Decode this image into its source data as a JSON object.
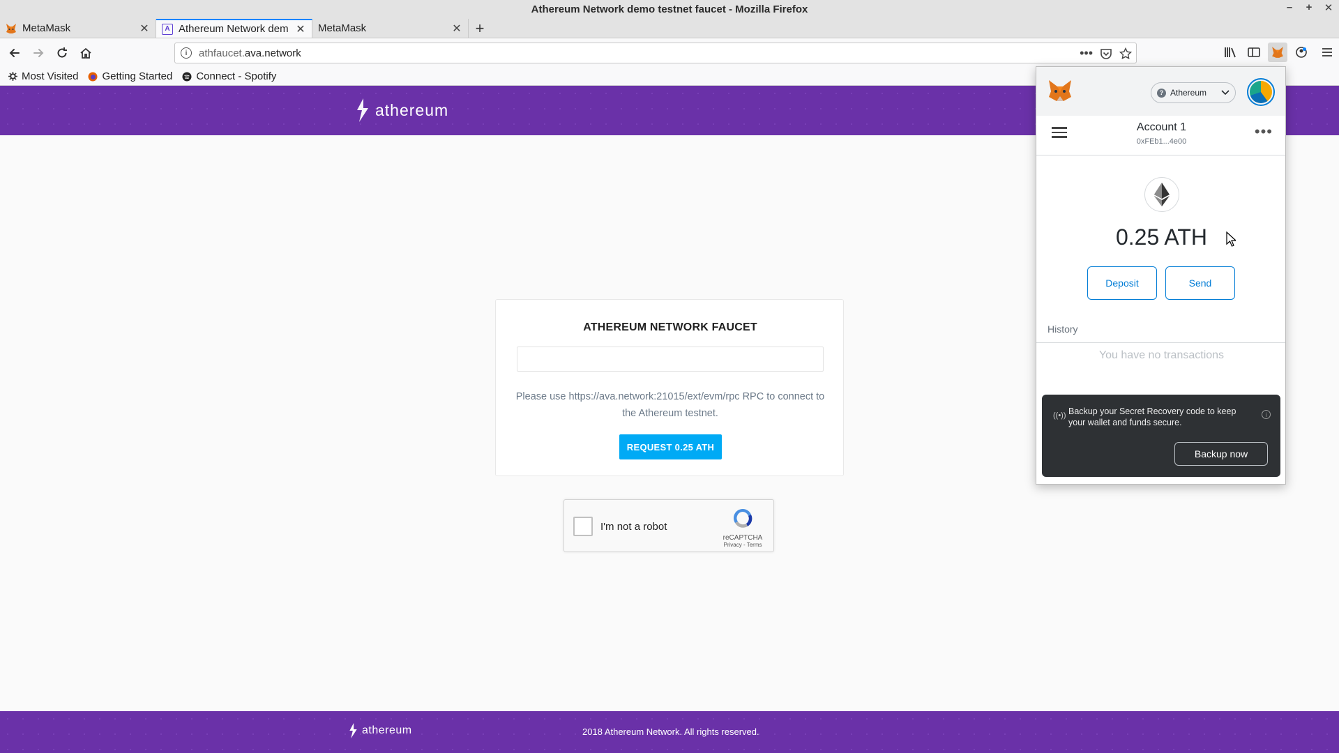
{
  "window": {
    "title": "Athereum Network demo testnet faucet - Mozilla Firefox",
    "controls": [
      "–",
      "+",
      "✕"
    ]
  },
  "tabs": [
    {
      "label": "MetaMask",
      "active": false
    },
    {
      "label": "Athereum Network dem",
      "active": true
    },
    {
      "label": "MetaMask",
      "active": false
    }
  ],
  "urlbar": {
    "url_dim": "athfaucet.",
    "url_host": "ava.network"
  },
  "bookmarks": [
    "Most Visited",
    "Getting Started",
    "Connect - Spotify"
  ],
  "page": {
    "brand": "athereum",
    "card_title": "ATHEREUM NETWORK FAUCET",
    "address_value": "",
    "address_placeholder": "",
    "note": "Please use https://ava.network:21015/ext/evm/rpc RPC to connect to the Athereum testnet.",
    "request_button": "REQUEST 0.25 ATH",
    "captcha": {
      "label": "I'm not a robot",
      "brand": "reCAPTCHA",
      "terms": "Privacy - Terms"
    },
    "footer_brand": "athereum",
    "footer_copy": "2018 Athereum Network. All rights reserved."
  },
  "metamask": {
    "network": "Athereum",
    "account_name": "Account 1",
    "account_address": "0xFEb1...4e00",
    "balance": "0.25 ATH",
    "deposit_label": "Deposit",
    "send_label": "Send",
    "history_label": "History",
    "empty_text": "You have no transactions",
    "backup_text": "Backup your Secret Recovery code to keep your wallet and funds secure.",
    "backup_button": "Backup now"
  },
  "colors": {
    "brand_purple": "#6a31a8",
    "request_blue": "#00aaf5",
    "metamask_blue": "#037dd6",
    "firefox_accent": "#0a84ff"
  }
}
